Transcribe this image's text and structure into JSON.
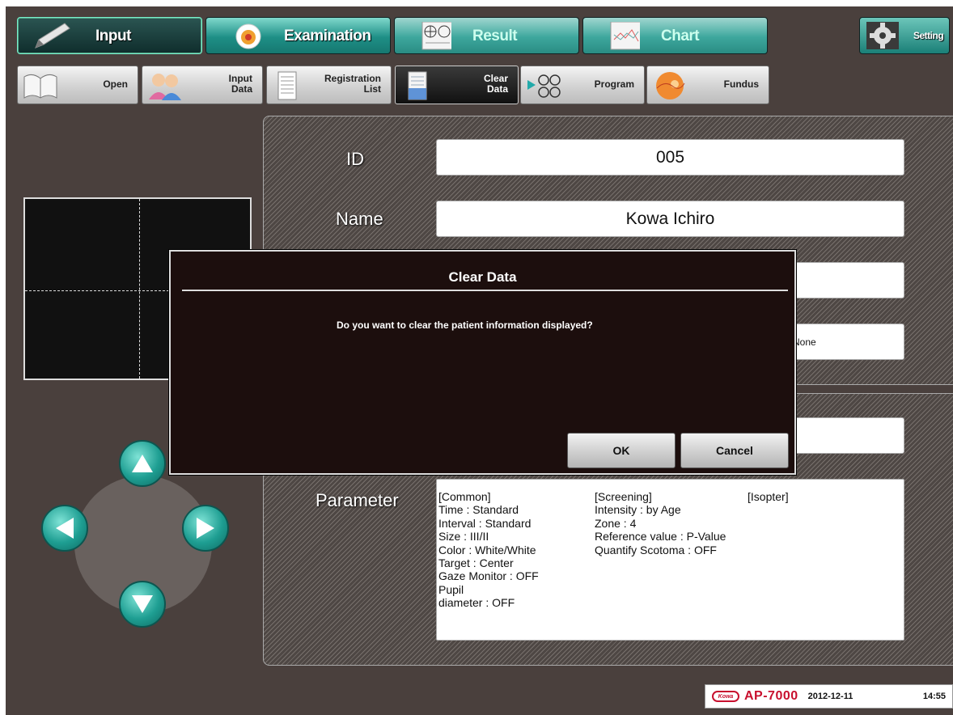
{
  "main_tabs": {
    "input": "Input",
    "examination": "Examination",
    "result": "Result",
    "chart": "Chart",
    "setting": "Setting"
  },
  "toolbar": {
    "open": "Open",
    "input_data": "Input\nData",
    "registration_list": "Registration\nList",
    "clear_data": "Clear\nData",
    "program": "Program",
    "fundus": "Fundus"
  },
  "patient": {
    "id_label": "ID",
    "id_value": "005",
    "name_label": "Name",
    "name_value": "Kowa Ichiro",
    "extra_value_partial": "None"
  },
  "parameter": {
    "label": "Parameter",
    "common": [
      "[Common]",
      "Time : Standard",
      "Interval : Standard",
      "Size : III/II",
      "Color : White/White",
      "Target : Center",
      "Gaze Monitor : OFF",
      "Pupil",
      "diameter : OFF"
    ],
    "screening": [
      "[Screening]",
      "Intensity : by Age",
      "Zone : 4",
      "Reference value : P-Value",
      "Quantify Scotoma : OFF"
    ],
    "isopter": [
      "[Isopter]"
    ]
  },
  "dialog": {
    "title": "Clear Data",
    "message": "Do you want to clear the patient information displayed?",
    "ok": "OK",
    "cancel": "Cancel"
  },
  "footer": {
    "brand": "Kowa",
    "model": "AP-7000",
    "date": "2012-12-11",
    "time": "14:55"
  },
  "colors": {
    "background": "#4a403d",
    "accent_teal": "#1e9e92",
    "dialog_bg": "#1c0e0d",
    "brand_red": "#c8102e"
  }
}
